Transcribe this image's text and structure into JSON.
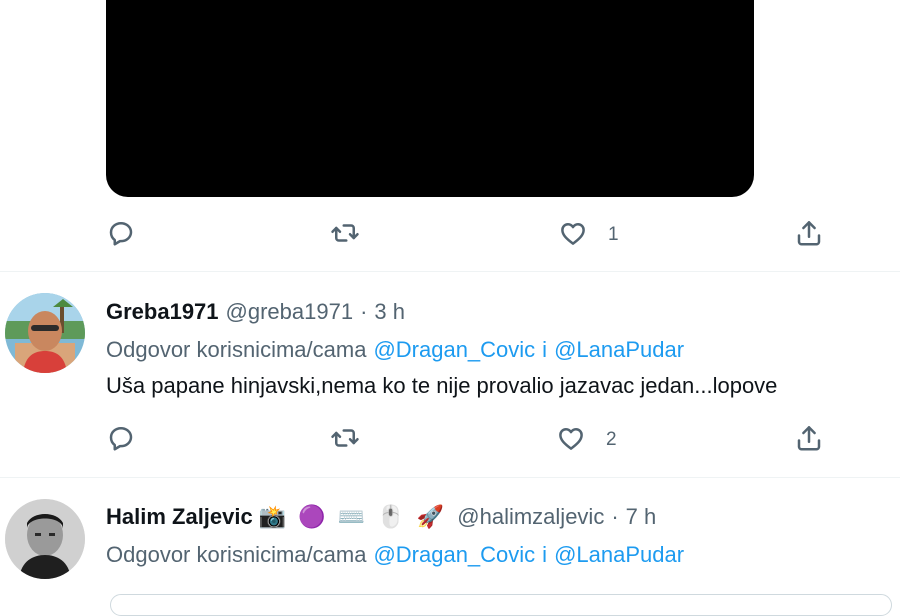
{
  "colors": {
    "text_primary": "#0f1419",
    "text_secondary": "#536471",
    "mention": "#1d9bf0",
    "divider": "#eff3f4"
  },
  "tweets": [
    {
      "media": {
        "type": "video",
        "background": "#000000"
      },
      "actions": {
        "reply": {
          "icon": "reply-icon",
          "count": ""
        },
        "retweet": {
          "icon": "retweet-icon",
          "count": ""
        },
        "like": {
          "icon": "heart-icon",
          "count": "1"
        },
        "share": {
          "icon": "share-icon"
        }
      }
    },
    {
      "avatar": "avatar-photo",
      "display_name": "Greba1971",
      "handle": "@greba1971",
      "separator": "·",
      "time": "3 h",
      "reply_prefix": "Odgovor korisnicima/cama",
      "reply_mention_1": "@Dragan_Covic",
      "reply_conjunction": "i",
      "reply_mention_2": "@LanaPudar",
      "text": "Uša papane hinjavski,nema ko te nije provalio jazavac jedan...lopove",
      "actions": {
        "reply": {
          "icon": "reply-icon",
          "count": ""
        },
        "retweet": {
          "icon": "retweet-icon",
          "count": ""
        },
        "like": {
          "icon": "heart-icon",
          "count": "2"
        },
        "share": {
          "icon": "share-icon"
        }
      }
    },
    {
      "avatar": "avatar-photo",
      "display_name": "Halim Zaljevic",
      "emojis": [
        "📸",
        "🟣",
        "⌨️",
        "🖱️",
        "🚀"
      ],
      "handle": "@halimzaljevic",
      "separator": "·",
      "time": "7 h",
      "reply_prefix": "Odgovor korisnicima/cama",
      "reply_mention_1": "@Dragan_Covic",
      "reply_conjunction": "i",
      "reply_mention_2": "@LanaPudar"
    }
  ]
}
